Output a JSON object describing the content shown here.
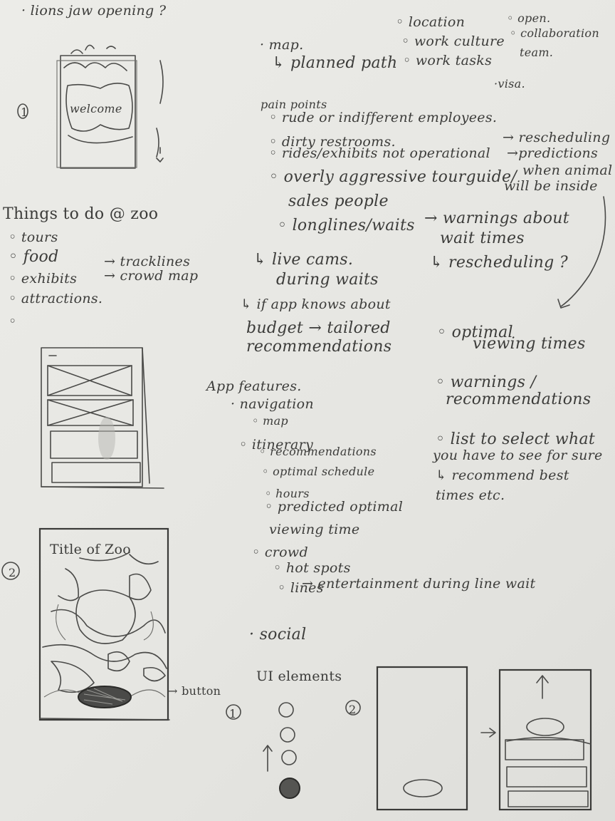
{
  "top_left": {
    "title": "· lions jaw opening ?",
    "number": "1",
    "welcome": "welcome"
  },
  "map_notes": {
    "map": "· map.",
    "planned_path": "↳ planned path",
    "location": "◦ location",
    "work_culture": "◦ work culture",
    "work_tasks": "◦ work tasks",
    "open": "◦ open.",
    "collaboration": "◦ collaboration",
    "team": "team.",
    "visa": "·visa."
  },
  "pain_points": {
    "heading": "pain points",
    "items": [
      "◦ rude or indifferent employees.",
      "◦ dirty restrooms.",
      "◦ rides/exhibits not operational",
      "◦ overly aggressive tourguide/",
      "sales people",
      "◦ longlines/waits"
    ],
    "right_notes": [
      "→ rescheduling",
      "→predictions",
      "when animal",
      "will be inside"
    ],
    "wait_notes": [
      "→ warnings about",
      "wait times",
      "↳ rescheduling ?"
    ],
    "live_cams": [
      "↳ live cams.",
      "during waits"
    ],
    "budget": [
      "↳ if app knows about",
      "budget → tailored",
      "recommendations"
    ]
  },
  "things_to_do": {
    "heading": "Things to do @ zoo",
    "items": [
      "◦ tours",
      "◦ food",
      "◦ exhibits",
      "◦ attractions.",
      "◦"
    ],
    "tracklines": "→ tracklines",
    "crowd_map": "→ crowd map"
  },
  "right_column": {
    "optimal": [
      "◦ optimal",
      "viewing times"
    ],
    "warnings": [
      "◦ warnings /",
      "recommendations"
    ],
    "list": [
      "◦ list to select what",
      "you have to see for sure",
      "↳ recommend best",
      "times etc."
    ]
  },
  "app_features": {
    "heading": "App features.",
    "navigation": "· navigation",
    "map": "◦ map",
    "itinerary": "◦ itinerary",
    "itinerary_items": [
      "◦ recommendations",
      "◦ optimal schedule",
      "◦ hours",
      "◦ predicted optimal",
      "viewing time"
    ],
    "crowd": "◦ crowd",
    "hot_spots": "◦ hot spots",
    "lines": "◦ lines",
    "entertainment": "→ entertainment during line wait",
    "social": "· social"
  },
  "map_sketch": {
    "number": "2",
    "title": "Title of Zoo",
    "button_label": "→ button"
  },
  "ui_elements": {
    "heading": "UI elements",
    "num1": "1",
    "num2": "2"
  },
  "colors": {
    "paper": "#e9e9e5",
    "pencil": "#3a3a38"
  }
}
